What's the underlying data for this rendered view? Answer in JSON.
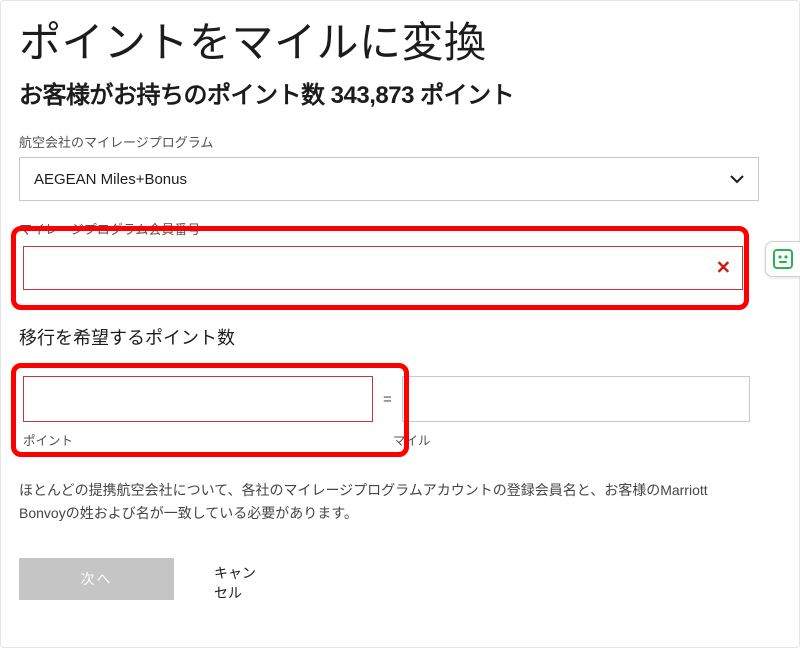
{
  "title": "ポイントをマイルに変換",
  "subheading": "お客様がお持ちのポイント数 343,873 ポイント",
  "program": {
    "label": "航空会社のマイレージプログラム",
    "selected": "AEGEAN Miles+Bonus"
  },
  "member_number": {
    "label": "マイレージプログラム会員番号",
    "value": ""
  },
  "desired": {
    "heading": "移行を希望するポイント数",
    "points_value": "",
    "equals": "=",
    "miles_value": "",
    "points_label": "ポイント",
    "miles_label": "マイル"
  },
  "note": "ほとんどの提携航空会社について、各社のマイレージプログラムアカウントの登録会員名と、お客様のMarriott Bonvoyの姓および名が一致している必要があります。",
  "buttons": {
    "next": "次へ",
    "cancel": "キャンセル"
  },
  "icons": {
    "clear": "✕"
  }
}
